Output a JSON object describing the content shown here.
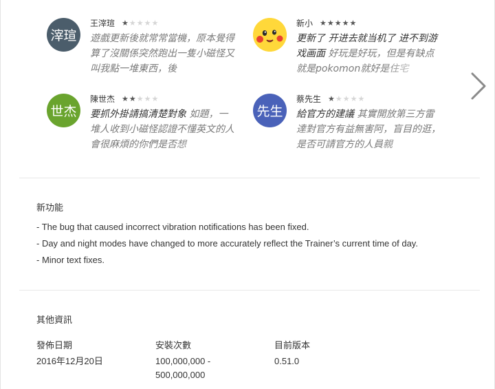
{
  "reviews": [
    {
      "author": "王滓瑄",
      "avatar_text": "滓瑄",
      "rating": 1,
      "highlight": "",
      "text": "遊戲更新後就常常當機，原本覺得算了沒關係突然跑出一隻小磁怪又叫我點一堆東西，後"
    },
    {
      "author": "新小",
      "avatar_text": "",
      "rating": 5,
      "highlight": "更新了 开进去就当机了 进不到游戏画面",
      "text": " 好玩是好玩，但是有缺点就是pokomon就好是住宅"
    },
    {
      "author": "陳世杰",
      "avatar_text": "世杰",
      "rating": 2,
      "highlight": "要抓外掛請搞清楚對象",
      "text": " 如題，一堆人收到小磁怪認證不懂英文的人會很麻煩的你們是否想"
    },
    {
      "author": "蔡先生",
      "avatar_text": "先生",
      "rating": 1,
      "highlight": "給官方的建議",
      "text": " 其實開放第三方雷達對官方有益無害阿，盲目的逛，是否可請官方的人員親"
    }
  ],
  "whats_new": {
    "title": "新功能",
    "lines": [
      "- The bug that caused incorrect vibration notifications has been fixed.",
      "- Day and night modes have changed to more accurately reflect the Trainer’s current time of day.",
      "- Minor text fixes."
    ]
  },
  "additional_info": {
    "title": "其他資訊",
    "fields": [
      {
        "label": "發佈日期",
        "value": "2016年12月20日"
      },
      {
        "label": "安裝次數",
        "value": "100,000,000 - 500,000,000"
      },
      {
        "label": "目前版本",
        "value": "0.51.0"
      }
    ]
  }
}
